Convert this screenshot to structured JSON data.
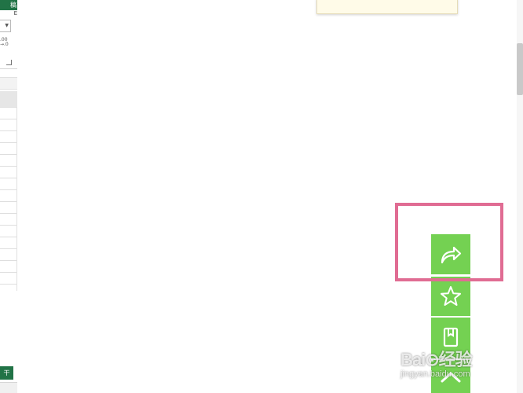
{
  "excel": {
    "ribbon_tab": "稿",
    "ribbon_label": "E",
    "sheet_tab": "干"
  },
  "toolbar": {
    "buttons": [
      {
        "name": "share",
        "icon": "share-arrow-icon"
      },
      {
        "name": "favorite",
        "icon": "star-icon"
      },
      {
        "name": "save",
        "icon": "bookmark-book-icon"
      },
      {
        "name": "back-to-top",
        "icon": "chevron-up-icon"
      }
    ],
    "color": "#74d152"
  },
  "highlight": {
    "color": "#e06c93"
  },
  "watermark": {
    "logo_text": "Bai⊙经验",
    "url": "jingyan.baidu.com"
  }
}
